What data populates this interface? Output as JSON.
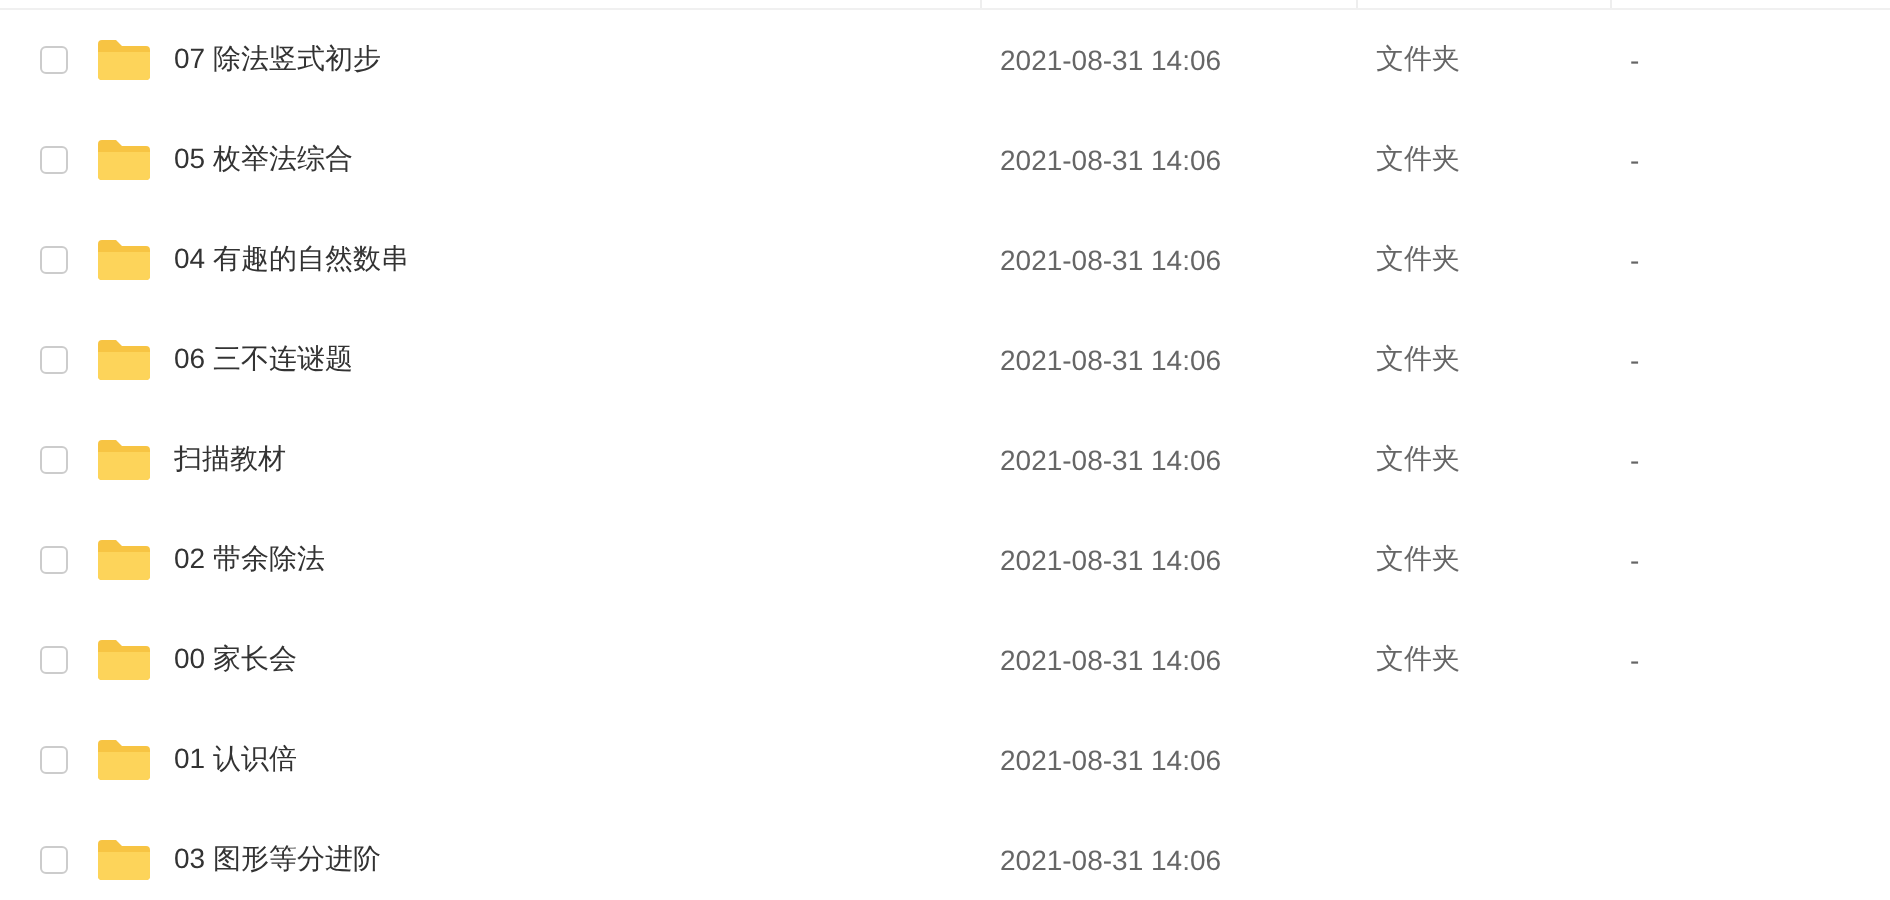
{
  "rows": [
    {
      "checked": false,
      "name": "07 除法竖式初步",
      "modified": "2021-08-31 14:06",
      "type": "文件夹",
      "size": "-"
    },
    {
      "checked": false,
      "name": "05 枚举法综合",
      "modified": "2021-08-31 14:06",
      "type": "文件夹",
      "size": "-"
    },
    {
      "checked": false,
      "name": "04 有趣的自然数串",
      "modified": "2021-08-31 14:06",
      "type": "文件夹",
      "size": "-"
    },
    {
      "checked": false,
      "name": "06 三不连谜题",
      "modified": "2021-08-31 14:06",
      "type": "文件夹",
      "size": "-"
    },
    {
      "checked": false,
      "name": "扫描教材",
      "modified": "2021-08-31 14:06",
      "type": "文件夹",
      "size": "-"
    },
    {
      "checked": false,
      "name": "02 带余除法",
      "modified": "2021-08-31 14:06",
      "type": "文件夹",
      "size": "-"
    },
    {
      "checked": false,
      "name": "00 家长会",
      "modified": "2021-08-31 14:06",
      "type": "文件夹",
      "size": "-"
    },
    {
      "checked": false,
      "name": "01 认识倍",
      "modified": "2021-08-31 14:06"
    },
    {
      "checked": false,
      "name": "03 图形等分进阶",
      "modified": "2021-08-31 14:06"
    }
  ]
}
